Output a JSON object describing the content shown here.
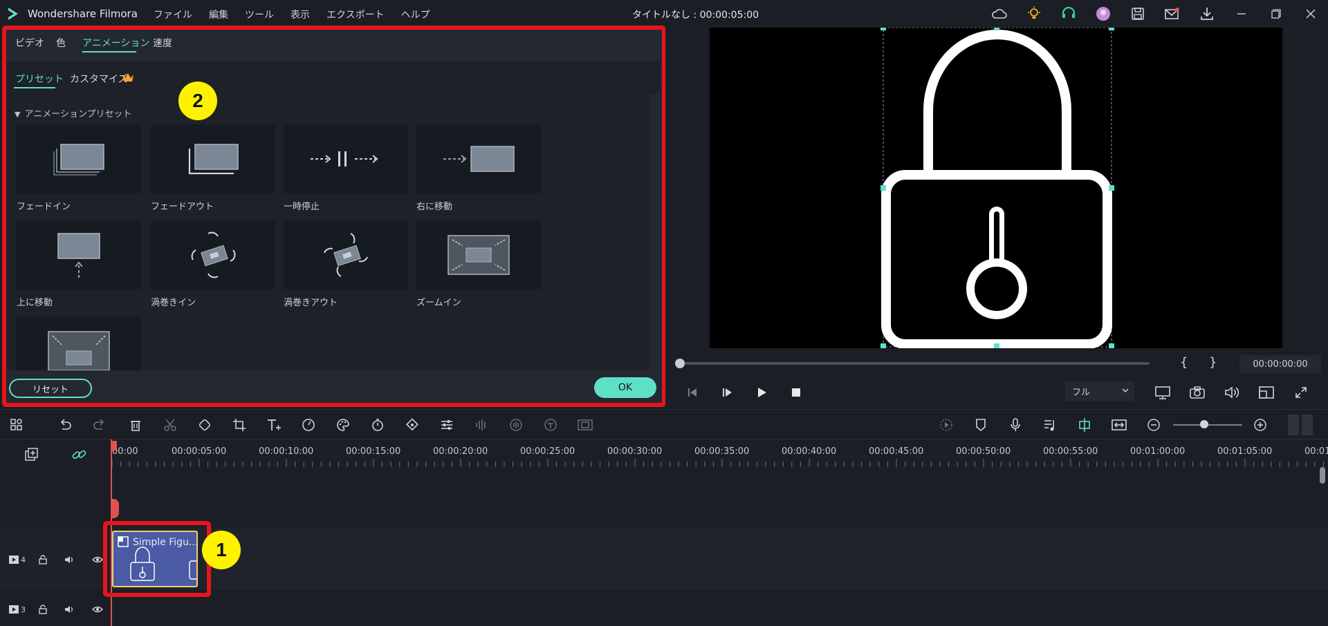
{
  "app": {
    "name": "Wondershare Filmora",
    "doc_title": "タイトルなし : 00:00:05:00"
  },
  "menu": [
    "ファイル",
    "編集",
    "ツール",
    "表示",
    "エクスポート",
    "ヘルプ"
  ],
  "panel": {
    "tabs": [
      "ビデオ",
      "色",
      "アニメーション",
      "速度"
    ],
    "active_tab": "アニメーション",
    "subtabs": [
      "プリセット",
      "カスタマイズ"
    ],
    "section": "アニメーションプリセット",
    "presets": [
      "フェードイン",
      "フェードアウト",
      "一時停止",
      "右に移動",
      "上に移動",
      "渦巻きイン",
      "渦巻きアウト",
      "ズームイン"
    ],
    "reset_label": "リセット",
    "ok_label": "OK"
  },
  "preview": {
    "timecode": "00:00:00:00",
    "brace_open": "{",
    "brace_close": "}",
    "quality": "フル"
  },
  "timeline": {
    "ticks": [
      "00:00",
      "00:00:05:00",
      "00:00:10:00",
      "00:00:15:00",
      "00:00:20:00",
      "00:00:25:00",
      "00:00:30:00",
      "00:00:35:00",
      "00:00:40:00",
      "00:00:45:00",
      "00:00:50:00",
      "00:00:55:00",
      "00:01:00:00",
      "00:01:05:00",
      "00:01:"
    ],
    "clip_title": "Simple Figu...",
    "track4": "4",
    "track3": "3"
  },
  "callouts": [
    "1",
    "2"
  ],
  "colors": {
    "accent": "#5ee0c7",
    "highlight": "#e8141b",
    "callout": "#fff200",
    "clip": "#4a5aa4"
  }
}
